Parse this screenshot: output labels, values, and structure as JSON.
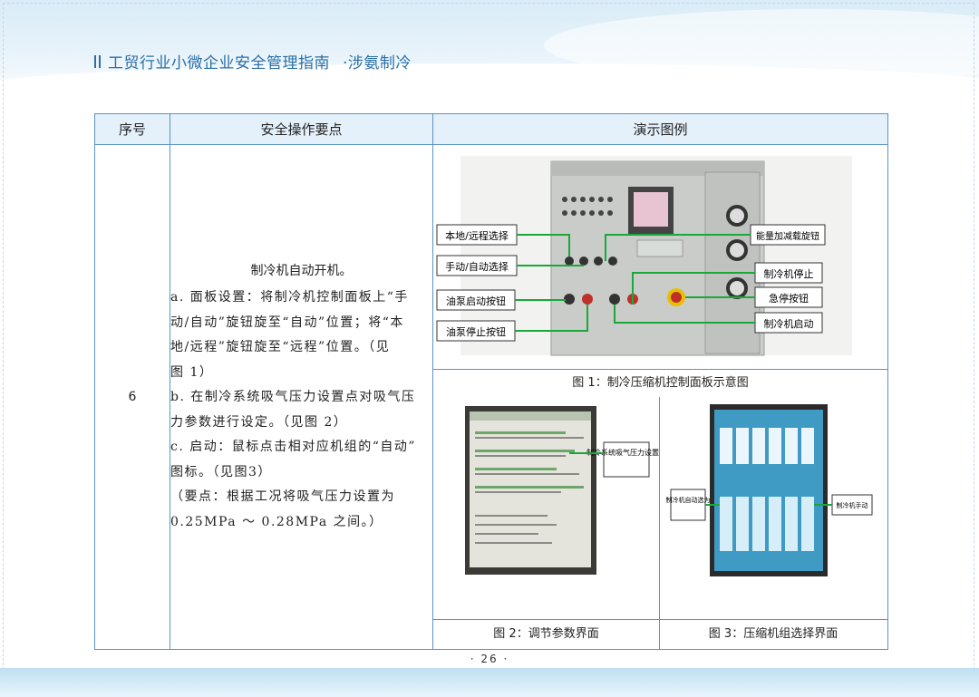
{
  "header": {
    "title": "工贸行业小微企业安全管理指南",
    "subtitle": "·涉氨制冷"
  },
  "table": {
    "columns": [
      "序号",
      "安全操作要点",
      "演示图例"
    ],
    "row": {
      "number": "6",
      "text_title": "制冷机自动开机。",
      "text_lines": [
        "a. 面板设置：将制冷机控制面板上“手",
        "动/自动”旋钮旋至“自动”位置；将“本",
        "地/远程”旋钮旋至“远程”位置。（见",
        "图 1）",
        "b. 在制冷系统吸气压力设置点对吸气压",
        "力参数进行设定。（见图 2）",
        "c. 启动：鼠标点击相对应机组的“自动”",
        "图标。（见图3）",
        "（要点：根据工况将吸气压力设置为",
        "0.25MPa ～ 0.28MPa 之间。）"
      ]
    }
  },
  "figure1": {
    "caption": "图 1：制冷压缩机控制面板示意图",
    "left_labels": [
      "本地/远程选择",
      "手动/自动选择",
      "油泵启动按钮",
      "油泵停止按钮"
    ],
    "right_labels": [
      "能量加减载旋钮",
      "制冷机停止",
      "急停按钮",
      "制冷机启动"
    ],
    "arrow_color": "#1aa83a"
  },
  "figure2": {
    "caption": "图 2：调节参数界面",
    "callout": "制冷系统吸气压力设置点"
  },
  "figure3": {
    "caption": "图 3：压缩机组选择界面",
    "callout_left": "制冷机自动选为",
    "callout_right": "制冷机手动"
  },
  "page_number": "· 26 ·",
  "colors": {
    "header_text": "#2a6fa8",
    "table_border": "#5b93c6",
    "table_header_bg": "#e4f0fa"
  }
}
